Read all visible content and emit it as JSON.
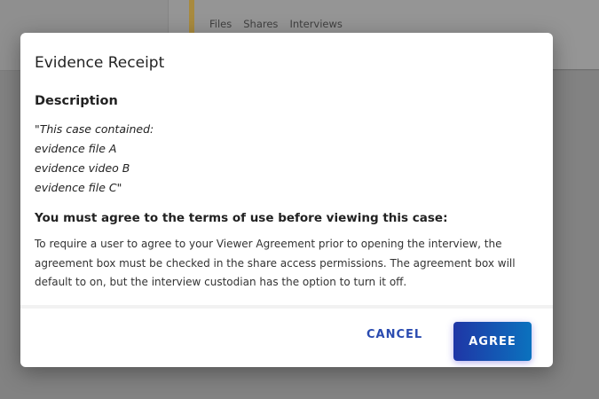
{
  "background": {
    "tabs": [
      "Files",
      "Shares",
      "Interviews"
    ]
  },
  "dialog": {
    "title": "Evidence Receipt",
    "description_heading": "Description",
    "description_lines": [
      "\"This case contained:",
      "evidence file A",
      "evidence video B",
      "evidence file C\""
    ],
    "terms_heading": "You must agree to the terms of use before viewing this case:",
    "terms_text": "To require a user to agree to your Viewer Agreement prior to opening the interview, the agreement box must be checked in the share access permissions. The agreement box will default to on, but the interview custodian has the option to turn it off.",
    "cancel_label": "CANCEL",
    "agree_label": "AGREE"
  }
}
